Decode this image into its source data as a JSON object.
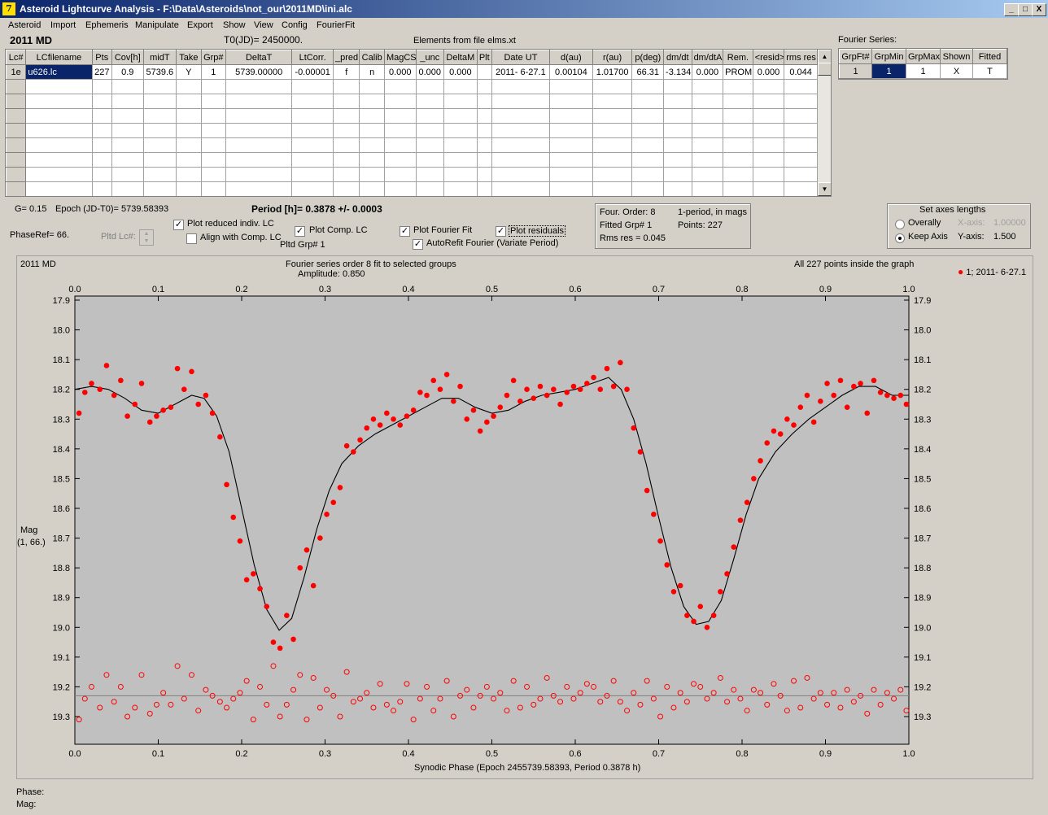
{
  "window": {
    "title": "Asteroid Lightcurve Analysis - F:\\Data\\Asteroids\\not_our\\2011MD\\ini.alc",
    "icon_glyph": "7",
    "min": "_",
    "max": "□",
    "close": "X"
  },
  "menu": [
    "Asteroid",
    "Import",
    "Ephemeris",
    "Manipulate",
    "Export",
    "Show",
    "View",
    "Config",
    "FourierFit"
  ],
  "header": {
    "asteroid": "2011 MD",
    "t0": "T0(JD)= 2450000.",
    "elements": "Elements from file elms.xt"
  },
  "lc_table": {
    "columns": [
      "Lc#",
      "LCfilename",
      "Pts",
      "Cov[h]",
      "midT",
      "Take",
      "Grp#",
      "DeltaT",
      "LtCorr.",
      "_pred.",
      "Calib",
      "MagCS",
      "_unc",
      "DeltaM",
      "Plt",
      "Date UT",
      "d(au)",
      "r(au)",
      "p(deg)",
      "dm/dt",
      "dm/dtA",
      "Rem.",
      "<resid>",
      "rms res"
    ],
    "rows": [
      [
        "1e",
        "u626.lc",
        "227",
        "0.9",
        "5739.6",
        "Y",
        "1",
        "5739.00000",
        "-0.00001",
        "f",
        "n",
        "0.000",
        "0.000",
        "0.000",
        "",
        "2011- 6-27.1",
        "0.00104",
        "1.01700",
        "66.31",
        "-3.134",
        "0.000",
        "PROM",
        "0.000",
        "0.044"
      ]
    ],
    "empty_rows": 8
  },
  "fourier_series": {
    "label": "Fourier Series:",
    "columns": [
      "GrpFt#",
      "GrpMin",
      "GrpMax",
      "Shown",
      "Fitted"
    ],
    "rows": [
      [
        "1",
        "1",
        "1",
        "X",
        "T"
      ]
    ]
  },
  "params": {
    "g": "G= 0.15",
    "epoch": "Epoch (JD-T0)= 5739.58393",
    "period": "Period [h]= 0.3878 +/- 0.0003",
    "phase_ref": "PhaseRef= 66.",
    "pltd_lc": "Pltd Lc#:",
    "pltd_grp": "Pltd Grp#  1"
  },
  "checkboxes": {
    "plot_reduced": {
      "label": "Plot reduced indiv. LC",
      "checked": true
    },
    "align_comp": {
      "label": "Align with Comp. LC",
      "checked": false
    },
    "plot_comp": {
      "label": "Plot Comp. LC",
      "checked": true
    },
    "plot_fourier": {
      "label": "Plot Fourier Fit",
      "checked": true
    },
    "plot_residuals": {
      "label": "Plot residuals",
      "checked": true
    },
    "autorefit": {
      "label": "AutoRefit Fourier (Variate Period)",
      "checked": true
    }
  },
  "fit_info": {
    "order": "Four. Order:  8",
    "one_period": "1-period, in mags",
    "fitted_grp": "Fitted Grp# 1",
    "points": "Points: 227",
    "rms": "Rms res     = 0.045"
  },
  "axes_box": {
    "title": "Set axes lengths",
    "overally": "Overally",
    "keep_axis": "Keep Axis",
    "selected": "keep_axis",
    "x_label": "X-axis:",
    "x_value": "1.00000",
    "y_label": "Y-axis:",
    "y_value": "1.500"
  },
  "chart_data": {
    "type": "scatter",
    "object": "2011 MD",
    "title": "Fourier series order 8 fit to selected groups",
    "subtitle": "Amplitude: 0.850",
    "note": "All 227 points inside the graph",
    "xlabel": "Synodic Phase (Epoch 2455739.58393, Period 0.3878 h)",
    "ylabel": "Mag",
    "ylabel2": "(1, 66.)",
    "legend": "1; 2011- 6-27.1",
    "xlim": [
      0,
      1
    ],
    "ylim": [
      17.9,
      19.3
    ],
    "y_inverted": true,
    "xticks": [
      "0.0",
      "0.1",
      "0.2",
      "0.3",
      "0.4",
      "0.5",
      "0.6",
      "0.7",
      "0.8",
      "0.9",
      "1.0"
    ],
    "yticks": [
      "17.9",
      "18.0",
      "18.1",
      "18.2",
      "18.3",
      "18.4",
      "18.5",
      "18.6",
      "18.7",
      "18.8",
      "18.9",
      "19.0",
      "19.1",
      "19.2",
      "19.3"
    ],
    "residual_zero": 19.23,
    "colors": {
      "points": "#ff0000",
      "fit": "#000000",
      "background": "#c0c0c0"
    },
    "fit_curve": [
      [
        0,
        18.2
      ],
      [
        0.02,
        18.19
      ],
      [
        0.04,
        18.2
      ],
      [
        0.06,
        18.23
      ],
      [
        0.08,
        18.27
      ],
      [
        0.1,
        18.28
      ],
      [
        0.12,
        18.25
      ],
      [
        0.14,
        18.22
      ],
      [
        0.155,
        18.23
      ],
      [
        0.17,
        18.29
      ],
      [
        0.185,
        18.41
      ],
      [
        0.2,
        18.6
      ],
      [
        0.215,
        18.79
      ],
      [
        0.23,
        18.94
      ],
      [
        0.245,
        19.01
      ],
      [
        0.26,
        18.97
      ],
      [
        0.275,
        18.83
      ],
      [
        0.29,
        18.67
      ],
      [
        0.305,
        18.54
      ],
      [
        0.32,
        18.45
      ],
      [
        0.34,
        18.39
      ],
      [
        0.36,
        18.35
      ],
      [
        0.38,
        18.32
      ],
      [
        0.4,
        18.29
      ],
      [
        0.42,
        18.26
      ],
      [
        0.44,
        18.23
      ],
      [
        0.46,
        18.23
      ],
      [
        0.48,
        18.26
      ],
      [
        0.5,
        18.28
      ],
      [
        0.52,
        18.27
      ],
      [
        0.54,
        18.24
      ],
      [
        0.56,
        18.22
      ],
      [
        0.58,
        18.21
      ],
      [
        0.6,
        18.2
      ],
      [
        0.62,
        18.18
      ],
      [
        0.64,
        18.16
      ],
      [
        0.655,
        18.2
      ],
      [
        0.67,
        18.3
      ],
      [
        0.685,
        18.45
      ],
      [
        0.7,
        18.63
      ],
      [
        0.715,
        18.8
      ],
      [
        0.73,
        18.93
      ],
      [
        0.745,
        18.99
      ],
      [
        0.76,
        18.98
      ],
      [
        0.775,
        18.91
      ],
      [
        0.79,
        18.77
      ],
      [
        0.805,
        18.62
      ],
      [
        0.82,
        18.5
      ],
      [
        0.84,
        18.41
      ],
      [
        0.86,
        18.35
      ],
      [
        0.88,
        18.3
      ],
      [
        0.9,
        18.26
      ],
      [
        0.92,
        18.22
      ],
      [
        0.94,
        18.19
      ],
      [
        0.96,
        18.19
      ],
      [
        0.98,
        18.22
      ],
      [
        1.0,
        18.22
      ]
    ],
    "x": [
      0.005,
      0.012,
      0.02,
      0.03,
      0.038,
      0.047,
      0.055,
      0.063,
      0.072,
      0.08,
      0.09,
      0.098,
      0.106,
      0.115,
      0.123,
      0.131,
      0.14,
      0.148,
      0.157,
      0.165,
      0.174,
      0.182,
      0.19,
      0.198,
      0.206,
      0.214,
      0.222,
      0.23,
      0.238,
      0.246,
      0.254,
      0.262,
      0.27,
      0.278,
      0.286,
      0.294,
      0.302,
      0.31,
      0.318,
      0.326,
      0.334,
      0.342,
      0.35,
      0.358,
      0.366,
      0.374,
      0.382,
      0.39,
      0.398,
      0.406,
      0.414,
      0.422,
      0.43,
      0.438,
      0.446,
      0.454,
      0.462,
      0.47,
      0.478,
      0.486,
      0.494,
      0.502,
      0.51,
      0.518,
      0.526,
      0.534,
      0.542,
      0.55,
      0.558,
      0.566,
      0.574,
      0.582,
      0.59,
      0.598,
      0.606,
      0.614,
      0.622,
      0.63,
      0.638,
      0.646,
      0.654,
      0.662,
      0.67,
      0.678,
      0.686,
      0.694,
      0.702,
      0.71,
      0.718,
      0.726,
      0.734,
      0.742,
      0.75,
      0.758,
      0.766,
      0.774,
      0.782,
      0.79,
      0.798,
      0.806,
      0.814,
      0.822,
      0.83,
      0.838,
      0.846,
      0.854,
      0.862,
      0.87,
      0.878,
      0.886,
      0.894,
      0.902,
      0.91,
      0.918,
      0.926,
      0.934,
      0.942,
      0.95,
      0.958,
      0.966,
      0.974,
      0.982,
      0.99,
      0.997
    ],
    "y": [
      18.28,
      18.21,
      18.18,
      18.2,
      18.12,
      18.22,
      18.17,
      18.29,
      18.25,
      18.18,
      18.31,
      18.29,
      18.27,
      18.26,
      18.13,
      18.2,
      18.14,
      18.25,
      18.22,
      18.28,
      18.36,
      18.52,
      18.63,
      18.71,
      18.84,
      18.82,
      18.87,
      18.93,
      19.05,
      19.07,
      18.96,
      19.04,
      18.8,
      18.74,
      18.86,
      18.7,
      18.62,
      18.58,
      18.53,
      18.39,
      18.41,
      18.37,
      18.33,
      18.3,
      18.32,
      18.28,
      18.3,
      18.32,
      18.29,
      18.27,
      18.21,
      18.22,
      18.17,
      18.2,
      18.15,
      18.24,
      18.19,
      18.3,
      18.27,
      18.34,
      18.31,
      18.29,
      18.26,
      18.22,
      18.17,
      18.24,
      18.2,
      18.23,
      18.19,
      18.22,
      18.2,
      18.25,
      18.21,
      18.19,
      18.2,
      18.18,
      18.16,
      18.2,
      18.13,
      18.19,
      18.11,
      18.2,
      18.33,
      18.41,
      18.54,
      18.62,
      18.71,
      18.79,
      18.88,
      18.86,
      18.96,
      18.98,
      18.93,
      19.0,
      18.96,
      18.88,
      18.82,
      18.73,
      18.64,
      18.58,
      18.5,
      18.44,
      18.38,
      18.34,
      18.35,
      18.3,
      18.32,
      18.26,
      18.22,
      18.31,
      18.24,
      18.18,
      18.22,
      18.17,
      18.26,
      18.19,
      18.18,
      18.28,
      18.17,
      18.21,
      18.22,
      18.23,
      18.22,
      18.25
    ],
    "residuals": [
      19.31,
      19.24,
      19.2,
      19.27,
      19.16,
      19.25,
      19.2,
      19.3,
      19.27,
      19.16,
      19.29,
      19.26,
      19.22,
      19.26,
      19.13,
      19.24,
      19.16,
      19.28,
      19.21,
      19.23,
      19.25,
      19.27,
      19.24,
      19.22,
      19.18,
      19.31,
      19.2,
      19.26,
      19.13,
      19.3,
      19.26,
      19.21,
      19.16,
      19.31,
      19.17,
      19.27,
      19.21,
      19.23,
      19.3,
      19.15,
      19.25,
      19.24,
      19.22,
      19.27,
      19.19,
      19.26,
      19.28,
      19.25,
      19.19,
      19.31,
      19.24,
      19.2,
      19.28,
      19.24,
      19.18,
      19.3,
      19.23,
      19.21,
      19.27,
      19.23,
      19.2,
      19.24,
      19.22,
      19.28,
      19.18,
      19.27,
      19.2,
      19.26,
      19.24,
      19.17,
      19.23,
      19.25,
      19.2,
      19.24,
      19.22,
      19.19,
      19.2,
      19.25,
      19.23,
      19.18,
      19.25,
      19.28,
      19.22,
      19.26,
      19.18,
      19.24,
      19.3,
      19.2,
      19.27,
      19.22,
      19.25,
      19.19,
      19.2,
      19.24,
      19.22,
      19.17,
      19.25,
      19.21,
      19.24,
      19.28,
      19.21,
      19.22,
      19.26,
      19.19,
      19.23,
      19.28,
      19.18,
      19.27,
      19.17,
      19.24,
      19.22,
      19.26,
      19.22,
      19.27,
      19.21,
      19.25,
      19.23,
      19.29,
      19.21,
      19.26,
      19.22,
      19.24,
      19.21,
      19.28
    ]
  },
  "status": {
    "phase": "Phase:",
    "mag": "Mag:"
  }
}
